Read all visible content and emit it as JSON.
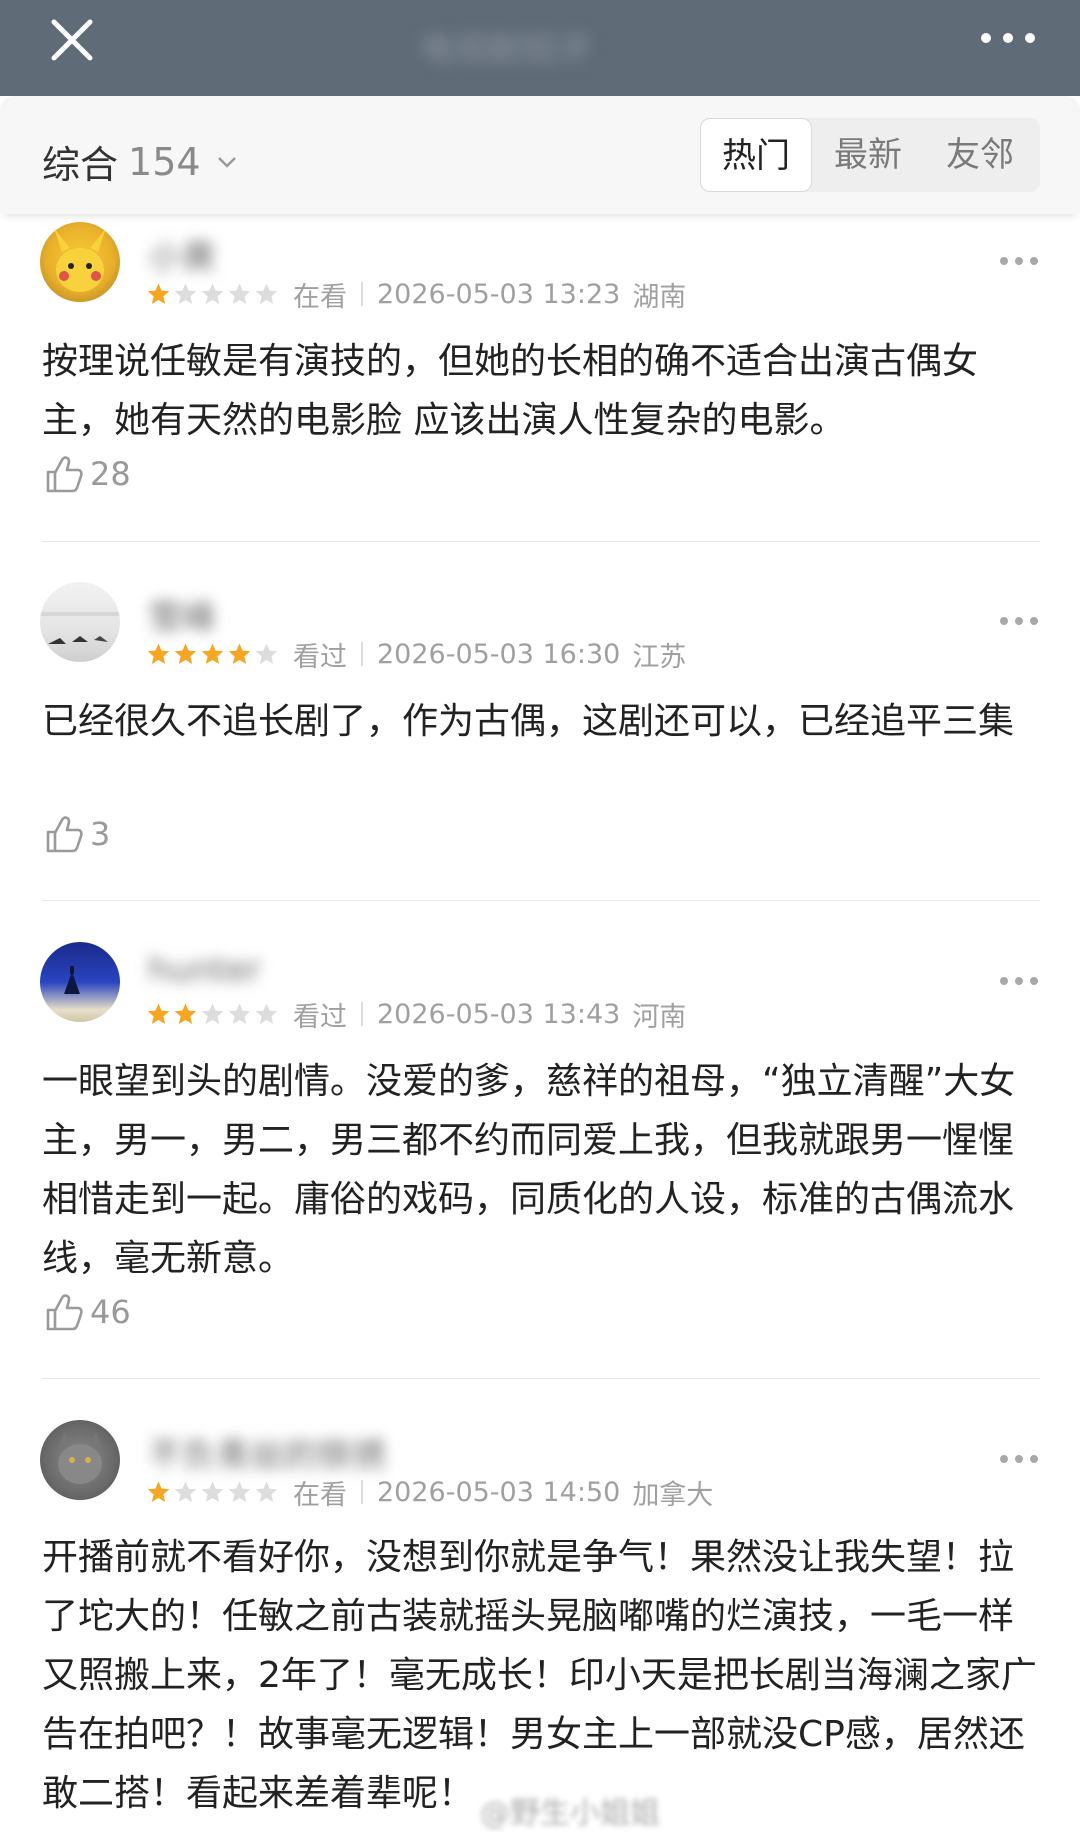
{
  "header": {
    "title": "电视剧短评",
    "close_icon": "close-icon",
    "more_icon": "more-icon"
  },
  "filter": {
    "sort_label": "综合",
    "count": "154",
    "tabs": [
      "热门",
      "最新",
      "友邻"
    ],
    "active_tab": "热门"
  },
  "comments": [
    {
      "username": "小黄",
      "rating": 1,
      "status": "在看",
      "time": "2026-05-03 13:23",
      "location": "湖南",
      "text": "按理说任敏是有演技的，但她的长相的确不适合出演古偶女主，她有天然的电影脸 应该出演人性复杂的电影。",
      "likes": "28"
    },
    {
      "username": "雪峰",
      "rating": 4,
      "status": "看过",
      "time": "2026-05-03 16:30",
      "location": "江苏",
      "text": "已经很久不追长剧了，作为古偶，这剧还可以，已经追平三集",
      "likes": "3"
    },
    {
      "username": "hunter",
      "rating": 2,
      "status": "看过",
      "time": "2026-05-03 13:43",
      "location": "河南",
      "text": "一眼望到头的剧情。没爱的爹，慈祥的祖母，“独立清醒”大女主，男一，男二，男三都不约而同爱上我，但我就跟男一惺惺相惜走到一起。庸俗的戏码，同质化的人设，标准的古偶流水线，毫无新意。",
      "likes": "46"
    },
    {
      "username": "不负青丝的铁锈",
      "rating": 1,
      "status": "在看",
      "time": "2026-05-03 14:50",
      "location": "加拿大",
      "text": "开播前就不看好你，没想到你就是争气！果然没让我失望！拉了坨大的！任敏之前古装就摇头晃脑嘟嘴的烂演技，一毛一样又照搬上来，2年了！毫无成长！印小天是把长剧当海澜之家广告在拍吧？！故事毫无逻辑！男女主上一部就没CP感，居然还敢二搭！看起来差着辈呢！",
      "likes": ""
    }
  ],
  "watermark": "@野生小姐姐",
  "colors": {
    "topbar": "#5f6b77",
    "star": "#f5a623",
    "star_empty": "#dddddd"
  }
}
